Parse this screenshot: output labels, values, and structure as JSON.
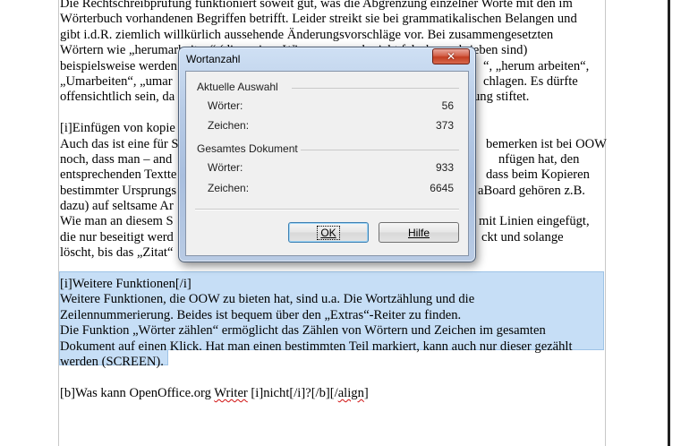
{
  "document": {
    "lines_top": [
      "Die Rechtschreibprüfung funktioniert soweit gut, was die Abgrenzung einzelner Worte mit den im",
      "Wörterbuch vorhandenen Begriffen betrifft. Leider streikt sie bei grammatikalischen Belangen und",
      "gibt i.d.R. ziemlich willkürlich aussehende Änderungsvorschläge vor. Bei zusammengesetzten",
      "Wörtern wie „herumarbeiten“ (die meines Wissens so auch nicht falsch geschrieben sind)",
      "beispielsweise werden",
      "„Umarbeiten“, „umar",
      "offensichtlich sein, da"
    ],
    "lines_top_right": {
      "line5": "“, „herum arbeiten“,",
      "line6": "chlagen. Es dürfte",
      "line7": "ung stiftet."
    },
    "lines_mid_left": [
      "[i]Einfügen von kopie",
      "Auch das ist eine für S",
      "noch, dass man – and",
      "entsprechenden Textte",
      "bestimmter Ursprungs",
      "dazu) auf seltsame Ar",
      "Wie man an diesem S",
      "die nur beseitigt werd",
      "löscht, bis das „Zitat“"
    ],
    "lines_mid_right": [
      "",
      "bemerken ist bei OOW",
      "nfügen hat, den",
      "dass beim Kopieren",
      "aBoard gehören z.B.",
      "",
      "mit Linien eingefügt,",
      "ckt und solange",
      ""
    ],
    "selected_lines": [
      "[i]Weitere Funktionen[/i]",
      "Weitere Funktionen, die OOW zu bieten hat, sind u.a. Die Wortzählung und die",
      "Zeilennummerierung. Beides ist bequem über den „Extras“-Reiter zu finden.",
      "Die Funktion „Wörter zählen“ ermöglicht das Zählen von Wörtern und Zeichen im gesamten",
      "Dokument auf einen Klick. Hat man einen bestimmten Teil markiert, kann auch nur dieser gezählt",
      "werden (SCREEN)."
    ],
    "last_line_parts": [
      "[b]Was kann OpenOffice.org ",
      "Writer",
      " [i]nicht[/i]?[/b][/",
      "align",
      "]"
    ]
  },
  "dialog": {
    "title": "Wortanzahl",
    "close_glyph": "✕",
    "selection_group": {
      "label": "Aktuelle Auswahl",
      "words_label": "Wörter:",
      "words_value": "56",
      "chars_label": "Zeichen:",
      "chars_value": "373"
    },
    "document_group": {
      "label": "Gesamtes Dokument",
      "words_label": "Wörter:",
      "words_value": "933",
      "chars_label": "Zeichen:",
      "chars_value": "6645"
    },
    "ok_label": "OK",
    "help_label": "Hilfe"
  },
  "colors": {
    "selection": "#c6def6",
    "spellcheck": "#d01010",
    "close_button": "#c23d22"
  }
}
